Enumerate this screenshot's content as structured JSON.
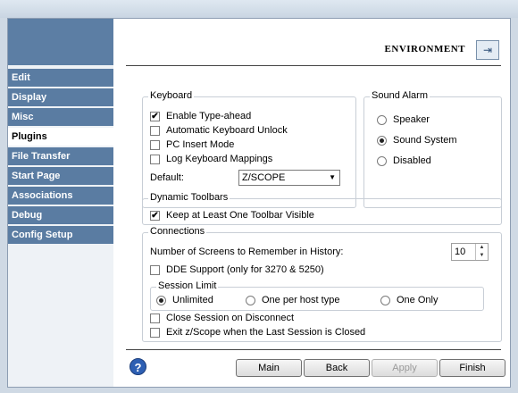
{
  "sidebar": {
    "items": [
      {
        "label": "Edit",
        "active": false
      },
      {
        "label": "Display",
        "active": false
      },
      {
        "label": "Misc",
        "active": false
      },
      {
        "label": "Plugins",
        "active": true
      },
      {
        "label": "File Transfer",
        "active": false
      },
      {
        "label": "Start Page",
        "active": false
      },
      {
        "label": "Associations",
        "active": false
      },
      {
        "label": "Debug",
        "active": false
      },
      {
        "label": "Config Setup",
        "active": false
      }
    ]
  },
  "header": {
    "title": "ENVIRONMENT",
    "icon": "environment-settings-icon"
  },
  "keyboard": {
    "legend": "Keyboard",
    "enable_type_ahead": {
      "label": "Enable Type-ahead",
      "checked": true
    },
    "auto_keyboard_unlock": {
      "label": "Automatic Keyboard Unlock",
      "checked": false
    },
    "pc_insert_mode": {
      "label": "PC Insert Mode",
      "checked": false
    },
    "log_keyboard_mappings": {
      "label": "Log Keyboard Mappings",
      "checked": false
    },
    "default_label": "Default:",
    "default_value": "Z/SCOPE"
  },
  "sound_alarm": {
    "legend": "Sound Alarm",
    "options": [
      {
        "label": "Speaker",
        "selected": false
      },
      {
        "label": "Sound System",
        "selected": true
      },
      {
        "label": "Disabled",
        "selected": false
      }
    ]
  },
  "toolbars": {
    "legend": "Dynamic Toolbars",
    "keep_one_visible": {
      "label": "Keep at Least One Toolbar Visible",
      "checked": true
    }
  },
  "connections": {
    "legend": "Connections",
    "history_label": "Number of Screens to Remember in History:",
    "history_value": "10",
    "dde_support": {
      "label": "DDE Support (only for 3270 & 5250)",
      "checked": false
    },
    "session_limit": {
      "legend": "Session Limit",
      "options": [
        {
          "label": "Unlimited",
          "selected": true
        },
        {
          "label": "One per host type",
          "selected": false
        },
        {
          "label": "One Only",
          "selected": false
        }
      ]
    },
    "close_on_disconnect": {
      "label": "Close Session on Disconnect",
      "checked": false
    },
    "exit_on_last_close": {
      "label": "Exit z/Scope when the Last Session is Closed",
      "checked": false
    }
  },
  "footer": {
    "help_label": "?",
    "main_label": "Main",
    "back_label": "Back",
    "apply_label": "Apply",
    "finish_label": "Finish"
  },
  "checkmark": "✔"
}
